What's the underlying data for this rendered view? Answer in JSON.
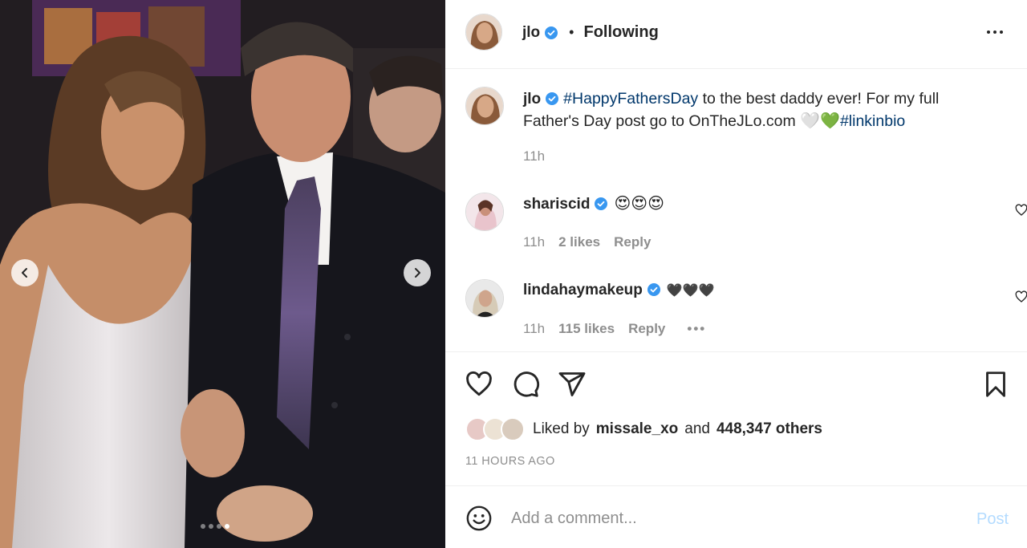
{
  "header": {
    "username": "jlo",
    "separator": "•",
    "follow_status": "Following"
  },
  "caption": {
    "username": "jlo",
    "hashtag1": "#HappyFathersDay",
    "text": " to the best daddy ever! For my full Father's Day post go to OnTheJLo.com ",
    "emojis": "🤍💚",
    "hashtag2": "#linkinbio",
    "time": "11h"
  },
  "comments": [
    {
      "username": "shariscid",
      "text": "😍😍😍",
      "time": "11h",
      "likes": "2 likes",
      "reply": "Reply"
    },
    {
      "username": "lindahaymakeup",
      "text": "🖤🖤🖤",
      "time": "11h",
      "likes": "115 likes",
      "reply": "Reply"
    }
  ],
  "likes": {
    "prefix": "Liked by",
    "first_user": "missale_xo",
    "and": "and",
    "others": "448,347 others"
  },
  "timestamp": "11 HOURS AGO",
  "add_comment": {
    "placeholder": "Add a comment...",
    "post_label": "Post"
  },
  "carousel": {
    "dot_count": 4,
    "active_index": 3
  },
  "colors": {
    "verified": "#3897f0",
    "hashtag": "#00376b",
    "post_disabled": "#b3dbff",
    "muted": "#8e8e8e"
  }
}
